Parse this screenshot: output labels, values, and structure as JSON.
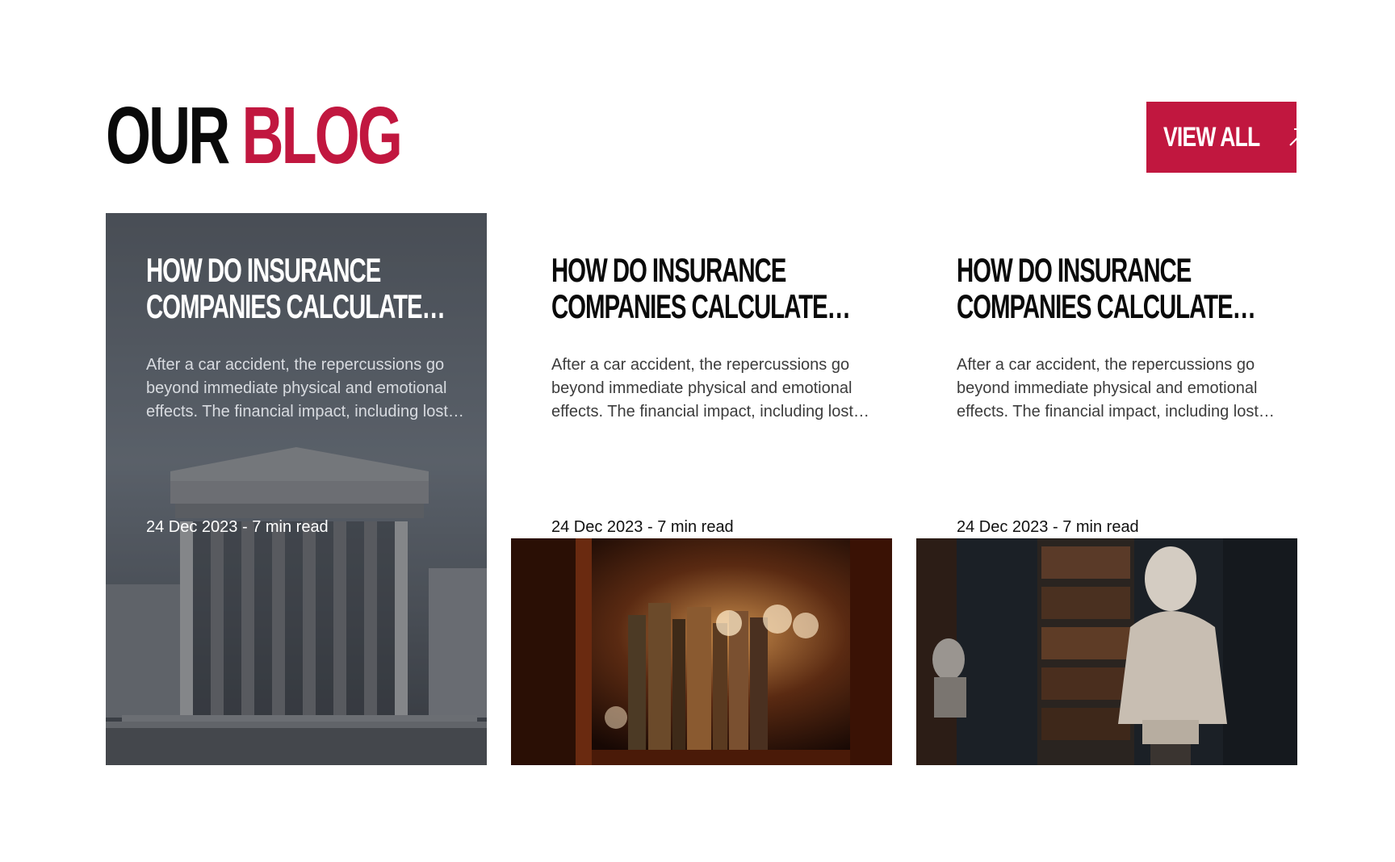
{
  "header": {
    "title_word_1": "OUR",
    "title_word_2": "BLOG",
    "view_all_label": "VIEW ALL",
    "view_all_icon": "arrow-up-right-icon"
  },
  "colors": {
    "accent": "#c1173f",
    "text_dark": "#0a0a0a",
    "text_body": "#3c3c3c"
  },
  "posts": [
    {
      "title": "HOW DO INSURANCE COMPANIES CALCULATE LOST WAGES",
      "excerpt": "After a car accident, the repercussions go beyond immediate physical and emotional effects. The financial impact, including lost wages and medical bills, can be overwhelming.",
      "meta": "24 Dec 2023 - 7 min read",
      "image": "courthouse-columns-photo",
      "featured": true
    },
    {
      "title": "HOW DO INSURANCE COMPANIES CALCULATE LOST WAGES",
      "excerpt": "After a car accident, the repercussions go beyond immediate physical and emotional effects. The financial impact, including lost wages and medical bills, can be overwhelming.",
      "meta": "24 Dec 2023 - 7 min read",
      "image": "library-bookshelf-photo",
      "featured": false
    },
    {
      "title": "HOW DO INSURANCE COMPANIES CALCULATE LOST WAGES",
      "excerpt": "After a car accident, the repercussions go beyond immediate physical and emotional effects. The financial impact, including lost wages and medical bills, can be overwhelming.",
      "meta": "24 Dec 2023 - 7 min read",
      "image": "library-bust-statue-photo",
      "featured": false
    }
  ]
}
